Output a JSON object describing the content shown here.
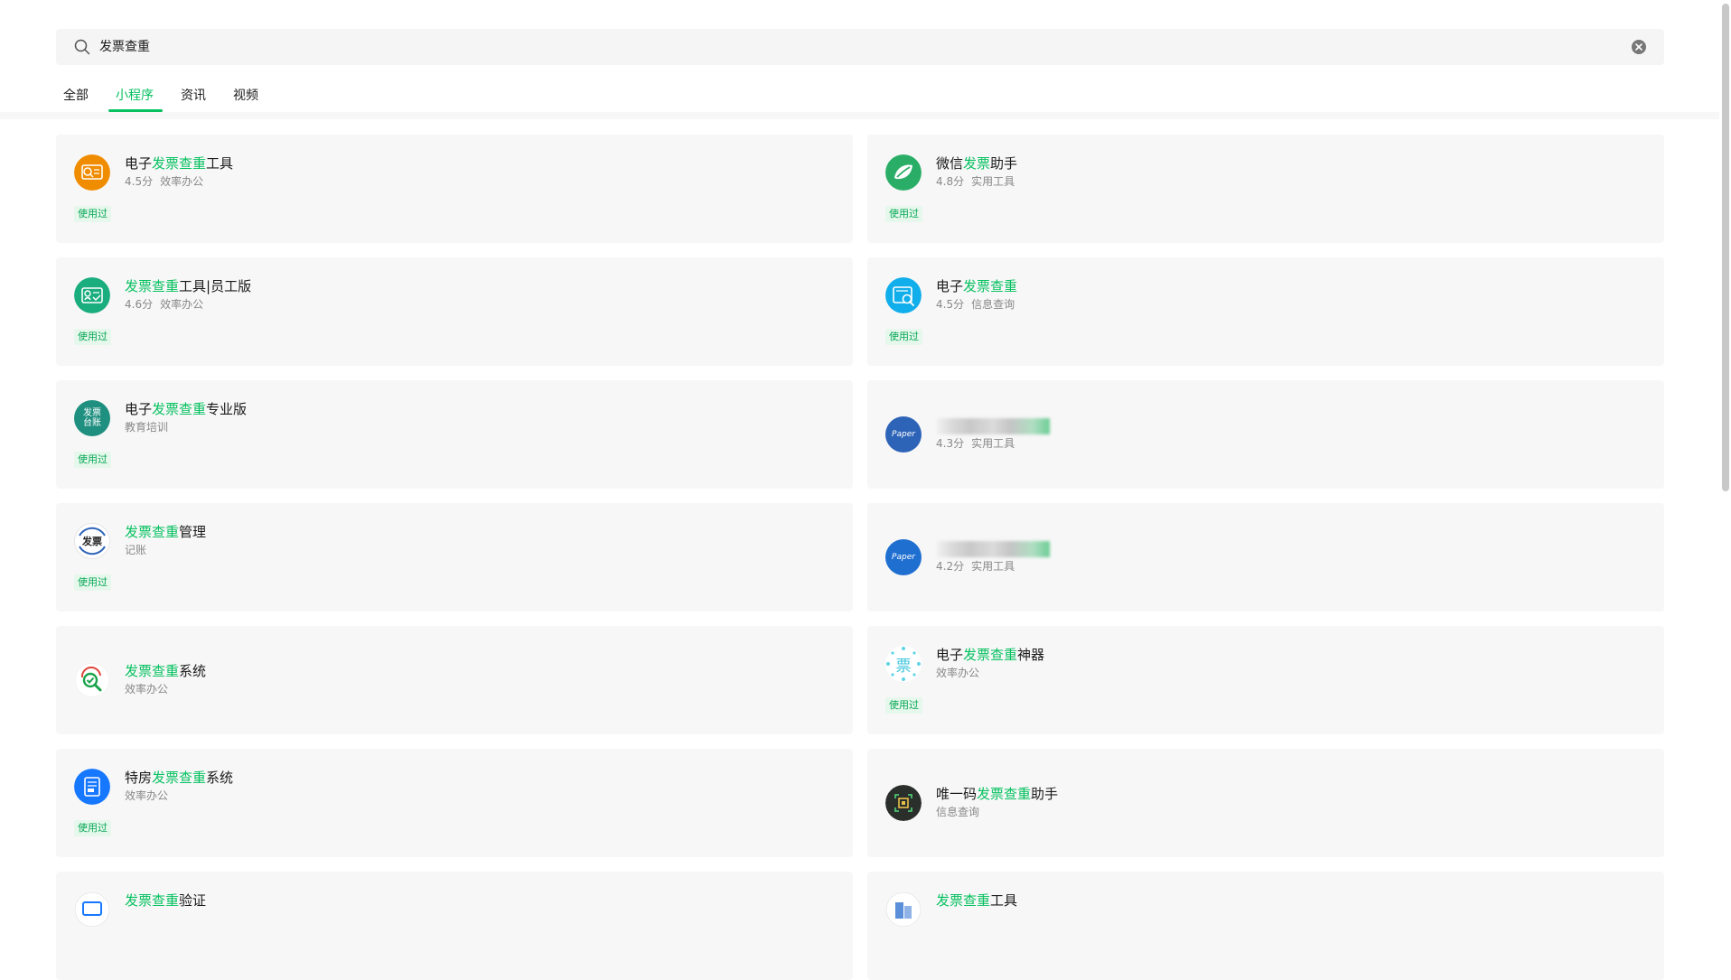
{
  "search": {
    "query": "发票查重"
  },
  "tabs": [
    {
      "label": "全部"
    },
    {
      "label": "小程序"
    },
    {
      "label": "资讯"
    },
    {
      "label": "视频"
    }
  ],
  "active_tab": "小程序",
  "used_label": "使用过",
  "results": [
    {
      "title_pre": "电子",
      "title_hl": "发票查重",
      "title_post": "工具",
      "rating": "4.5分",
      "category": "效率办公",
      "used": true,
      "icon": "invoice-search-icon",
      "icon_color": "#f08c00"
    },
    {
      "title_pre": "微信",
      "title_hl": "发票",
      "title_post": "助手",
      "rating": "4.8分",
      "category": "实用工具",
      "used": true,
      "icon": "leaf-icon",
      "icon_color": "#2aae67"
    },
    {
      "title_pre": "",
      "title_hl": "发票查重",
      "title_post": "工具|员工版",
      "rating": "4.6分",
      "category": "效率办公",
      "used": true,
      "icon": "invoice-check-icon",
      "icon_color": "#1aad7e"
    },
    {
      "title_pre": "电子",
      "title_hl": "发票查重",
      "title_post": "",
      "rating": "4.5分",
      "category": "信息查询",
      "used": true,
      "icon": "invoice-magnifier-icon",
      "icon_color": "#10aeea"
    },
    {
      "title_pre": "电子",
      "title_hl": "发票查重",
      "title_post": "专业版",
      "rating": "",
      "category": "教育培训",
      "used": true,
      "icon": "invoice-ledger-icon",
      "icon_color": "#1f8f80",
      "icon_text_1": "发票",
      "icon_text_2": "台账"
    },
    {
      "title_pre": "",
      "title_hl": "",
      "title_post": "",
      "rating": "4.3分",
      "category": "实用工具",
      "used": false,
      "blurred": true,
      "icon": "paper-logo-icon",
      "icon_color": "#2e64b8",
      "icon_text_1": "Paper"
    },
    {
      "title_pre": "",
      "title_hl": "发票查重",
      "title_post": "管理",
      "rating": "",
      "category": "记账",
      "used": true,
      "icon": "fapiao-logo-icon",
      "icon_color": "#ffffff",
      "icon_text_1": "发票"
    },
    {
      "title_pre": "",
      "title_hl": "",
      "title_post": "",
      "rating": "4.2分",
      "category": "实用工具",
      "used": false,
      "blurred": true,
      "icon": "paper-logo-icon",
      "icon_color": "#1f6fd1",
      "icon_text_1": "Paper"
    },
    {
      "title_pre": "",
      "title_hl": "发票查重",
      "title_post": "系统",
      "rating": "",
      "category": "效率办公",
      "used": false,
      "icon": "magnifier-check-icon",
      "icon_color": "#ffffff"
    },
    {
      "title_pre": "电子",
      "title_hl": "发票查重",
      "title_post": "神器",
      "rating": "",
      "category": "效率办公",
      "used": true,
      "icon": "piao-dots-icon",
      "icon_color": "#ffffff",
      "icon_text_1": "票"
    },
    {
      "title_pre": "特房",
      "title_hl": "发票查重",
      "title_post": "系统",
      "rating": "",
      "category": "效率办公",
      "used": true,
      "icon": "document-icon",
      "icon_color": "#1677ff"
    },
    {
      "title_pre": "唯一码",
      "title_hl": "发票查重",
      "title_post": "助手",
      "rating": "",
      "category": "信息查询",
      "used": false,
      "icon": "qr-scan-icon",
      "icon_color": "#2b2f2c"
    },
    {
      "title_pre": "",
      "title_hl": "发票查重",
      "title_post": "验证",
      "rating": "",
      "category": "",
      "used": false,
      "icon": "invoice-frame-icon",
      "icon_color": "#ffffff"
    },
    {
      "title_pre": "",
      "title_hl": "发票查重",
      "title_post": "工具",
      "rating": "",
      "category": "",
      "used": false,
      "icon": "building-icon",
      "icon_color": "#ffffff"
    }
  ]
}
